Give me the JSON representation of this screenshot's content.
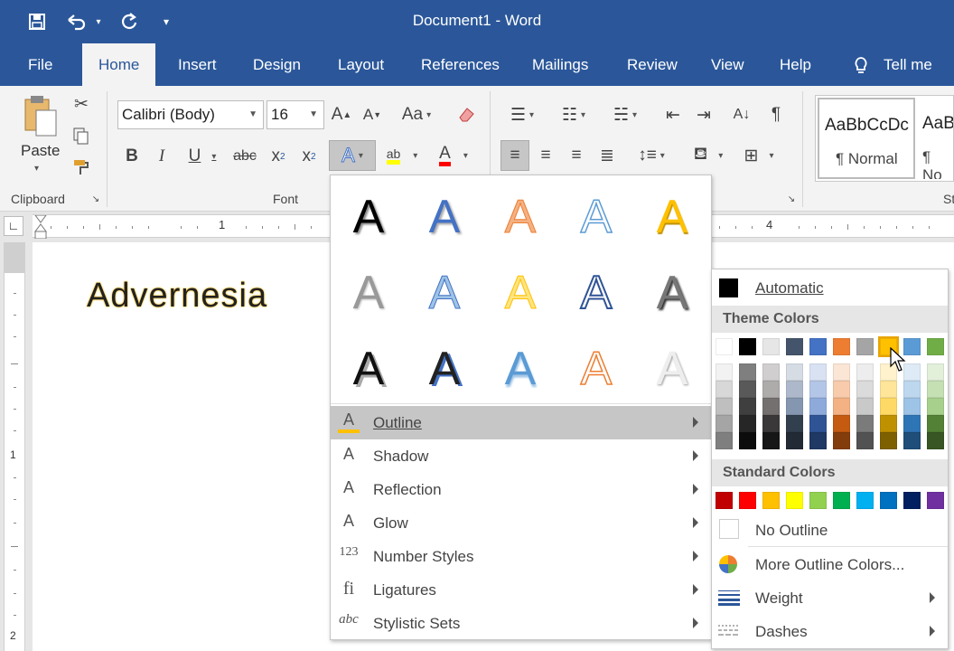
{
  "window": {
    "title": "Document1  -  Word"
  },
  "quick_access": {
    "save_icon": "save-icon",
    "undo_icon": "undo-icon",
    "redo_icon": "redo-icon",
    "customize_icon": "customize-qat-icon"
  },
  "tabs": [
    {
      "label": "File"
    },
    {
      "label": "Home"
    },
    {
      "label": "Insert"
    },
    {
      "label": "Design"
    },
    {
      "label": "Layout"
    },
    {
      "label": "References"
    },
    {
      "label": "Mailings"
    },
    {
      "label": "Review"
    },
    {
      "label": "View"
    },
    {
      "label": "Help"
    },
    {
      "label": "Tell me w"
    }
  ],
  "ribbon": {
    "clipboard": {
      "paste_label": "Paste",
      "group_label": "Clipboard"
    },
    "font": {
      "font_name": "Calibri (Body)",
      "font_size": "16",
      "group_label": "Font",
      "case_label": "Aa",
      "strike_label": "abc"
    },
    "styles": [
      {
        "sample": "AaBbCcDc",
        "name": "¶ Normal"
      },
      {
        "sample": "AaB",
        "name": "¶ No"
      }
    ],
    "styles_group_label": "St"
  },
  "ruler": {
    "marks": [
      "1",
      "4"
    ],
    "vmarks": [
      "1",
      "2"
    ]
  },
  "document": {
    "text": "Advernesia"
  },
  "text_effects_menu": {
    "items": [
      {
        "label": "Outline",
        "icon": "A"
      },
      {
        "label": "Shadow",
        "icon": "A"
      },
      {
        "label": "Reflection",
        "icon": "A"
      },
      {
        "label": "Glow",
        "icon": "A"
      },
      {
        "label": "Number Styles",
        "icon": "123"
      },
      {
        "label": "Ligatures",
        "icon": "fi"
      },
      {
        "label": "Stylistic Sets",
        "icon": "abc"
      }
    ]
  },
  "outline_menu": {
    "automatic_label": "Automatic",
    "theme_header": "Theme Colors",
    "standard_header": "Standard Colors",
    "no_outline_label": "No Outline",
    "more_colors_label": "More Outline Colors...",
    "weight_label": "Weight",
    "dashes_label": "Dashes",
    "theme_top": [
      "#ffffff",
      "#000000",
      "#e7e6e6",
      "#44546a",
      "#4472c4",
      "#ed7d31",
      "#a5a5a5",
      "#ffc000",
      "#5b9bd5",
      "#70ad47"
    ],
    "theme_shades": [
      [
        "#f2f2f2",
        "#7f7f7f",
        "#d0cece",
        "#d6dce4",
        "#d9e2f3",
        "#fbe5d5",
        "#ededed",
        "#fff2cc",
        "#deebf6",
        "#e2efd9"
      ],
      [
        "#d8d8d8",
        "#595959",
        "#aeabab",
        "#adb9ca",
        "#b4c6e7",
        "#f7cbac",
        "#dbdbdb",
        "#fee599",
        "#bdd7ee",
        "#c5e0b3"
      ],
      [
        "#bfbfbf",
        "#3f3f3f",
        "#757070",
        "#8496b0",
        "#8eaadb",
        "#f4b183",
        "#c9c9c9",
        "#ffd965",
        "#9dc3e6",
        "#a8d08d"
      ],
      [
        "#a5a5a5",
        "#262626",
        "#3a3838",
        "#323f4f",
        "#2f5496",
        "#c55a11",
        "#7b7b7b",
        "#bf9000",
        "#2e75b5",
        "#538135"
      ],
      [
        "#7f7f7f",
        "#0c0c0c",
        "#171616",
        "#222a35",
        "#1f3864",
        "#833c0b",
        "#525252",
        "#7f6000",
        "#1e4e79",
        "#375623"
      ]
    ],
    "standard": [
      "#c00000",
      "#ff0000",
      "#ffc000",
      "#ffff00",
      "#92d050",
      "#00b050",
      "#00b0f0",
      "#0070c0",
      "#002060",
      "#7030a0"
    ],
    "selected_color": "#ffc000"
  }
}
